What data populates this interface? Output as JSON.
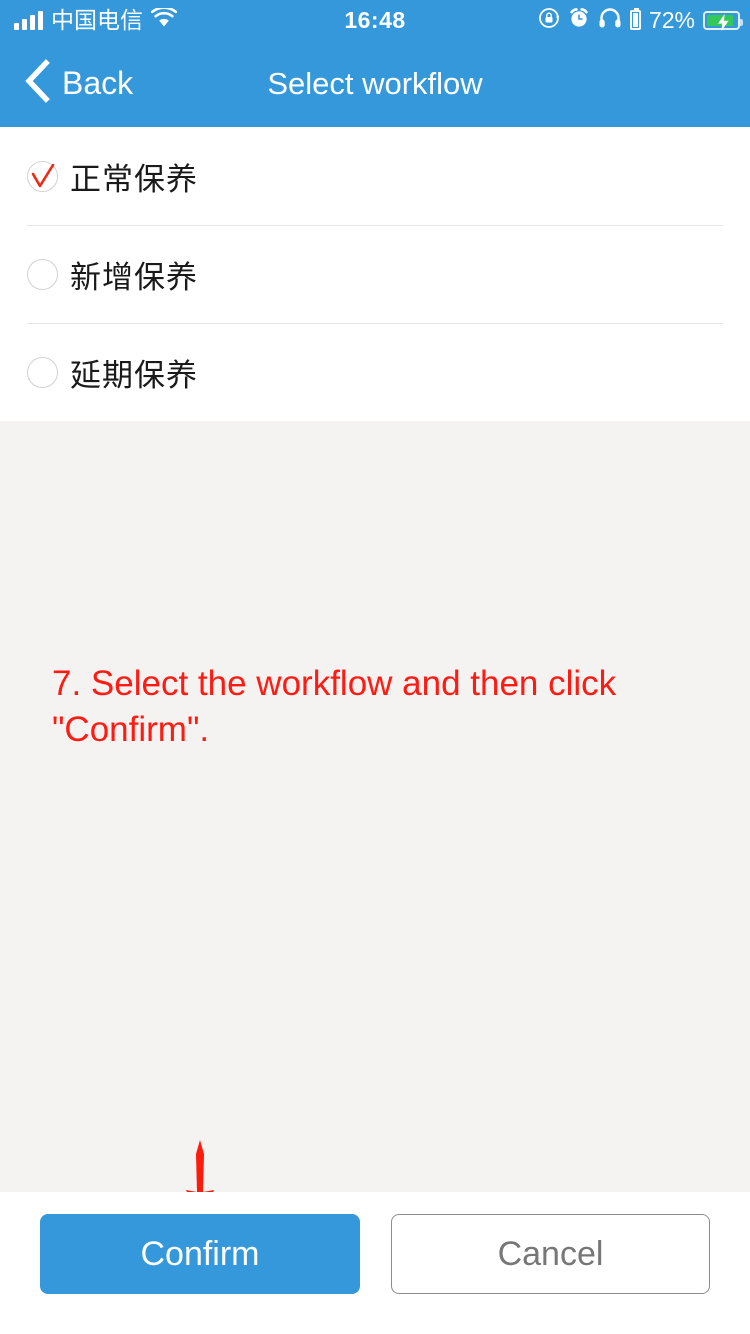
{
  "status_bar": {
    "carrier": "中国电信",
    "time": "16:48",
    "battery_percent": "72%",
    "icons": [
      "signal-bars-icon",
      "wifi-icon",
      "rotation-lock-icon",
      "alarm-clock-icon",
      "headphones-icon",
      "external-battery-icon",
      "battery-charging-icon"
    ]
  },
  "nav": {
    "back_label": "Back",
    "title": "Select workflow"
  },
  "options": [
    {
      "label": "正常保养",
      "selected": true
    },
    {
      "label": "新增保养",
      "selected": false
    },
    {
      "label": "延期保养",
      "selected": false
    }
  ],
  "annotation": {
    "text": "7. Select the workflow and then click \"Confirm\"."
  },
  "footer": {
    "confirm_label": "Confirm",
    "cancel_label": "Cancel"
  },
  "colors": {
    "accent_blue": "#3498db",
    "annotation_red": "#ff1a12",
    "page_background": "#f4f3f2",
    "check_red": "#ed2a13",
    "battery_green": "#34c759"
  }
}
